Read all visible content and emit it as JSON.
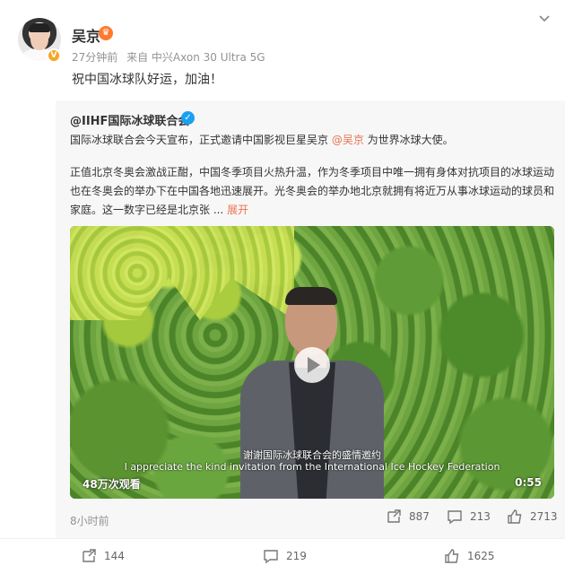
{
  "post": {
    "username": "吴京",
    "crown_icon": "crown-icon",
    "verified_icon": "orange-v-icon",
    "meta_time": "27分钟前",
    "meta_from": "来自 中兴Axon 30 Ultra 5G",
    "text": "祝中国冰球队好运，加油！"
  },
  "retweet": {
    "author": "@IIHF国际冰球联合会",
    "p1_before": "国际冰球联合会今天宣布，正式邀请中国影视巨星吴京 ",
    "p1_mention": "@吴京",
    "p1_after": " 为世界冰球大使。",
    "p2_text": "正值北京冬奥会激战正酣，中国冬季项目火热升温，作为冬季项目中唯一拥有身体对抗项目的冰球运动也在冬奥会的举办下在中国各地迅速展开。光冬奥会的举办地北京就拥有将近万从事冰球运动的球员和家庭。这一数字已经是北京张 ... ",
    "expand": "展开",
    "video": {
      "subtitle_cn": "谢谢国际冰球联合会的盛情邀约",
      "subtitle_en": "I appreciate the kind invitation from the International Ice Hockey Federation",
      "views": "48万次观看",
      "duration": "0:55"
    },
    "time": "8小时前",
    "reposts": "887",
    "comments": "213",
    "likes": "2713"
  },
  "footer": {
    "reposts": "144",
    "comments": "219",
    "likes": "1625"
  }
}
